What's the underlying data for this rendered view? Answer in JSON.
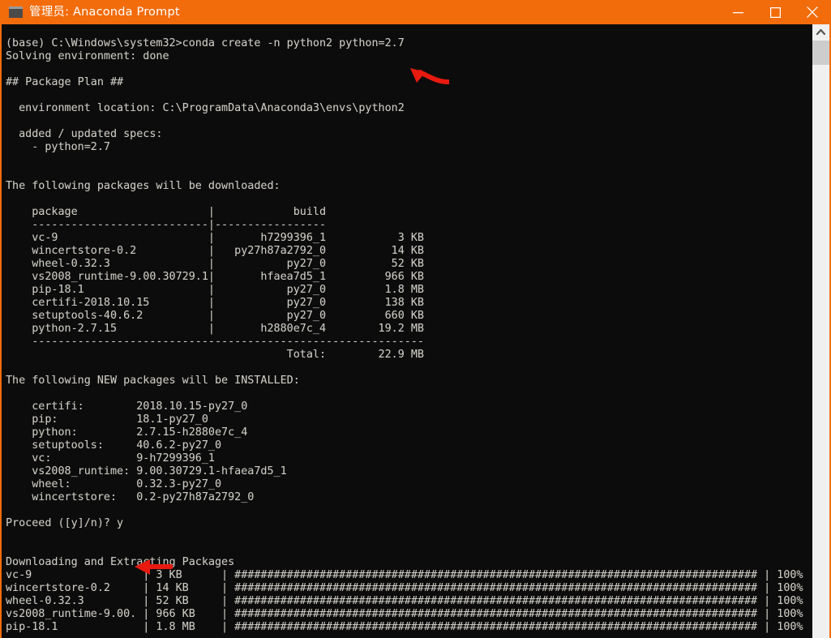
{
  "window": {
    "titlebar": {
      "icon": "console-icon",
      "title": "管理员: Anaconda Prompt",
      "accent_color": "#f36c0c",
      "buttons": [
        {
          "name": "minimize",
          "glyph": "─"
        },
        {
          "name": "maximize",
          "glyph": "□"
        },
        {
          "name": "close",
          "glyph": "✕"
        }
      ]
    },
    "console": {
      "background_color": "#0c0c0c",
      "text_color": "#ccc9c2",
      "prompt": "(base) C:\\Windows\\system32>",
      "command": "conda create -n python2 python=2.7",
      "lines": [
        "",
        "(base) C:\\Windows\\system32>conda create -n python2 python=2.7",
        "Solving environment: done",
        "",
        "## Package Plan ##",
        "",
        "  environment location: C:\\ProgramData\\Anaconda3\\envs\\python2",
        "",
        "  added / updated specs:",
        "    - python=2.7",
        "",
        "",
        "The following packages will be downloaded:",
        "",
        "    package                    |            build",
        "    ---------------------------|-----------------",
        "    vc-9                       |       h7299396_1           3 KB",
        "    wincertstore-0.2           |   py27h87a2792_0          14 KB",
        "    wheel-0.32.3               |           py27_0          52 KB",
        "    vs2008_runtime-9.00.30729.1|       hfaea7d5_1         966 KB",
        "    pip-18.1                   |           py27_0         1.8 MB",
        "    certifi-2018.10.15         |           py27_0         138 KB",
        "    setuptools-40.6.2          |           py27_0         660 KB",
        "    python-2.7.15              |       h2880e7c_4        19.2 MB",
        "    ------------------------------------------------------------",
        "                                           Total:        22.9 MB",
        "",
        "The following NEW packages will be INSTALLED:",
        "",
        "    certifi:        2018.10.15-py27_0",
        "    pip:            18.1-py27_0",
        "    python:         2.7.15-h2880e7c_4",
        "    setuptools:     40.6.2-py27_0",
        "    vc:             9-h7299396_1",
        "    vs2008_runtime: 9.00.30729.1-hfaea7d5_1",
        "    wheel:          0.32.3-py27_0",
        "    wincertstore:   0.2-py27h87a2792_0",
        "",
        "Proceed ([y]/n)? y",
        "",
        "",
        "Downloading and Extracting Packages",
        "vc-9                 | 3 KB      | ################################################################################ | 100%",
        "wincertstore-0.2     | 14 KB     | ################################################################################ | 100%",
        "wheel-0.32.3         | 52 KB     | ################################################################################ | 100%",
        "vs2008_runtime-9.00. | 966 KB    | ################################################################################ | 100%",
        "pip-18.1             | 1.8 MB    | ################################################################################ | 100%"
      ],
      "download_table": {
        "columns": [
          "package",
          "build",
          "size"
        ],
        "rows": [
          {
            "package": "vc-9",
            "build": "h7299396_1",
            "size": "3 KB"
          },
          {
            "package": "wincertstore-0.2",
            "build": "py27h87a2792_0",
            "size": "14 KB"
          },
          {
            "package": "wheel-0.32.3",
            "build": "py27_0",
            "size": "52 KB"
          },
          {
            "package": "vs2008_runtime-9.00.30729.1",
            "build": "hfaea7d5_1",
            "size": "966 KB"
          },
          {
            "package": "pip-18.1",
            "build": "py27_0",
            "size": "1.8 MB"
          },
          {
            "package": "certifi-2018.10.15",
            "build": "py27_0",
            "size": "138 KB"
          },
          {
            "package": "setuptools-40.6.2",
            "build": "py27_0",
            "size": "660 KB"
          },
          {
            "package": "python-2.7.15",
            "build": "h2880e7c_4",
            "size": "19.2 MB"
          }
        ],
        "total_label": "Total:",
        "total_size": "22.9 MB"
      },
      "installed_packages": [
        {
          "name": "certifi:",
          "version": "2018.10.15-py27_0"
        },
        {
          "name": "pip:",
          "version": "18.1-py27_0"
        },
        {
          "name": "python:",
          "version": "2.7.15-h2880e7c_4"
        },
        {
          "name": "setuptools:",
          "version": "40.6.2-py27_0"
        },
        {
          "name": "vc:",
          "version": "9-h7299396_1"
        },
        {
          "name": "vs2008_runtime:",
          "version": "9.00.30729.1-hfaea7d5_1"
        },
        {
          "name": "wheel:",
          "version": "0.32.3-py27_0"
        },
        {
          "name": "wincertstore:",
          "version": "0.2-py27h87a2792_0"
        }
      ],
      "prompt_question": "Proceed ([y]/n)? y",
      "prompt_answer": "y",
      "downloading_header": "Downloading and Extracting Packages",
      "progress_rows": [
        {
          "package": "vc-9",
          "size": "3 KB",
          "percent": "100%"
        },
        {
          "package": "wincertstore-0.2",
          "size": "14 KB",
          "percent": "100%"
        },
        {
          "package": "wheel-0.32.3",
          "size": "52 KB",
          "percent": "100%"
        },
        {
          "package": "vs2008_runtime-9.00.",
          "size": "966 KB",
          "percent": "100%"
        },
        {
          "package": "pip-18.1",
          "size": "1.8 MB",
          "percent": "100%"
        }
      ]
    },
    "scrollbar": {
      "up_arrow": "chevron-up-icon",
      "track_color": "#f0f0f0",
      "thumb_color": "#cdcdcd"
    },
    "annotations": [
      {
        "name": "arrow-pointing-at-command",
        "color": "#e81a10"
      },
      {
        "name": "arrow-pointing-at-proceed-answer",
        "color": "#e81a10"
      }
    ]
  }
}
